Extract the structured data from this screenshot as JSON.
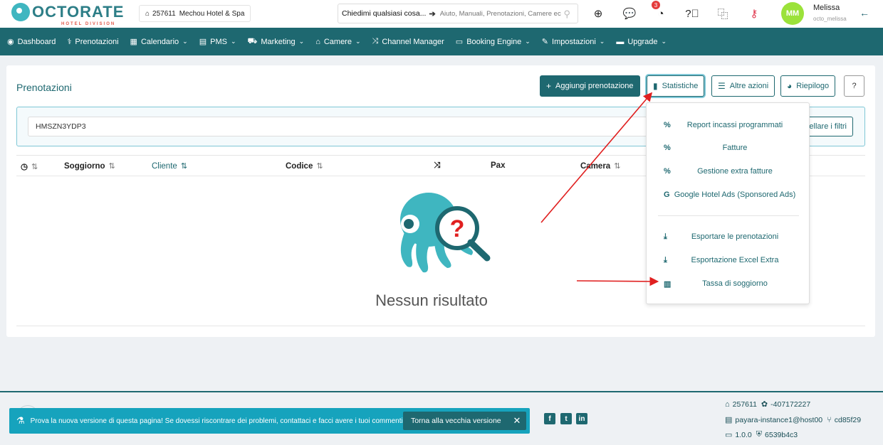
{
  "header": {
    "logo_text": "OCTORATE",
    "logo_sub": "HOTEL DIVISION",
    "hotel_id": "257611",
    "hotel_name": "Mechou Hotel & Spa",
    "ask_label": "Chiedimi qualsiasi cosa...",
    "ask_placeholder": "Aiuto, Manuali, Prenotazioni, Camere ecc",
    "notification_count": "3",
    "user": {
      "initials": "MM",
      "name": "Melissa",
      "handle": "octo_melissa"
    }
  },
  "nav": [
    {
      "label": "Dashboard",
      "icon": "dashboard-icon",
      "glyph": "◉",
      "dropdown": false
    },
    {
      "label": "Prenotazioni",
      "icon": "stethoscope-icon",
      "glyph": "⚕",
      "dropdown": false
    },
    {
      "label": "Calendario",
      "icon": "calendar-icon",
      "glyph": "▦",
      "dropdown": true
    },
    {
      "label": "PMS",
      "icon": "grid-icon",
      "glyph": "▤",
      "dropdown": true
    },
    {
      "label": "Marketing",
      "icon": "cart-icon",
      "glyph": "⛟",
      "dropdown": true
    },
    {
      "label": "Camere",
      "icon": "home-icon",
      "glyph": "⌂",
      "dropdown": true
    },
    {
      "label": "Channel Manager",
      "icon": "shuffle-icon",
      "glyph": "⤨",
      "dropdown": false
    },
    {
      "label": "Booking Engine",
      "icon": "monitor-icon",
      "glyph": "▭",
      "dropdown": true
    },
    {
      "label": "Impostazioni",
      "icon": "wrench-icon",
      "glyph": "✎",
      "dropdown": true
    },
    {
      "label": "Upgrade",
      "icon": "credit-card-icon",
      "glyph": "▬",
      "dropdown": true
    }
  ],
  "page": {
    "title": "Prenotazioni",
    "buttons": {
      "add": "Aggiungi prenotazione",
      "stats": "Statistiche",
      "more": "Altre azioni",
      "summary": "Riepilogo",
      "help": "?"
    },
    "filter_value": "HMSZN3YDP3",
    "cancel_filters": "ellare i filtri",
    "columns": {
      "stay": "Soggiorno",
      "client": "Cliente",
      "code": "Codice",
      "pax": "Pax",
      "room": "Camera"
    },
    "empty_text": "Nessun risultato"
  },
  "dropdown": {
    "items": [
      {
        "label": "Report incassi programmati",
        "icon": "percent-icon",
        "glyph": "%"
      },
      {
        "label": "Fatture",
        "icon": "percent-icon",
        "glyph": "%"
      },
      {
        "label": "Gestione extra fatture",
        "icon": "percent-icon",
        "glyph": "%"
      },
      {
        "label": "Google Hotel Ads (Sponsored Ads)",
        "icon": "google-icon",
        "glyph": "G"
      },
      {
        "label": "Esportare le prenotazioni",
        "icon": "download-icon",
        "glyph": "⤓"
      },
      {
        "label": "Esportazione Excel Extra",
        "icon": "download-icon",
        "glyph": "⤓"
      },
      {
        "label": "Tassa di soggiorno",
        "icon": "building-icon",
        "glyph": "▥"
      }
    ]
  },
  "banner": {
    "text": "Prova la nuova versione di questa pagina! Se dovessi riscontrare dei problemi, contattaci e facci avere i tuoi commenti.",
    "button": "Torna alla vecchia versione"
  },
  "footer": {
    "hotel_id": "257611",
    "instance_code": "-407172227",
    "server": "payara-instance1@host00",
    "branch": "cd85f29",
    "version": "1.0.0",
    "build": "6539b4c3"
  },
  "colors": {
    "primary": "#1e6870",
    "accent": "#3fb6c0",
    "banner": "#16a3bd",
    "arrow": "#e02020",
    "avatar": "#9be23a"
  }
}
